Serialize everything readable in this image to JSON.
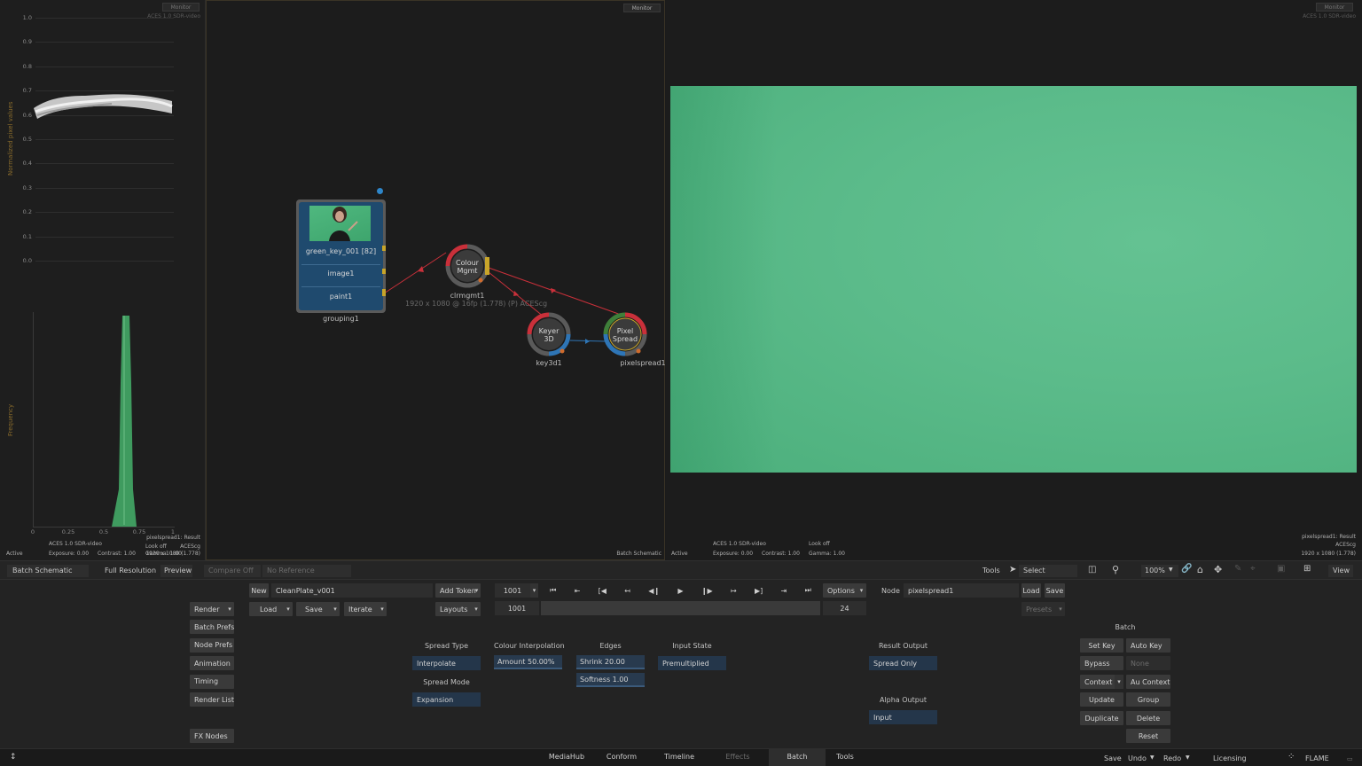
{
  "scope": {
    "monitor_btn": "Monitor",
    "colorspace_tag": "ACES 1.0 SDR-video",
    "y_axis_title": "Normalized pixel values",
    "y_ticks": [
      "1.0",
      "0.9",
      "0.8",
      "0.7",
      "0.6",
      "0.5",
      "0.4",
      "0.3",
      "0.2",
      "0.1",
      "0.0"
    ],
    "hist_axis_title": "Frequency",
    "hist_x_ticks": [
      "0",
      "0.25",
      "0.5",
      "0.75",
      "1"
    ],
    "footer": {
      "display": "ACES 1.0 SDR-video",
      "look": "Look off",
      "exposure": "Exposure: 0.00",
      "contrast": "Contrast: 1.00",
      "gamma": "Gamma: 1.00",
      "result": "pixelspread1: Result",
      "acescg": "ACEScg",
      "resolution": "1920 x 1080 (1.778)",
      "state": "Active"
    }
  },
  "schematic": {
    "monitor_btn": "Monitor",
    "group": {
      "clip_name": "green_key_001 [82]",
      "row2": "image1",
      "row3": "paint1",
      "label": "grouping1"
    },
    "colour_node": {
      "line1": "Colour",
      "line2": "Mgmt",
      "label": "clrmgmt1",
      "info": "1920 x 1080 @ 16fp (1.778) (P) ACEScg"
    },
    "keyer_node": {
      "line1": "Keyer",
      "line2": "3D",
      "label": "key3d1"
    },
    "spread_node": {
      "line1": "Pixel",
      "line2": "Spread",
      "label": "pixelspread1"
    },
    "footer_label": "Batch Schematic"
  },
  "viewer": {
    "monitor_btn": "Monitor",
    "colorspace_tag": "ACES 1.0 SDR-video",
    "footer": {
      "display": "ACES 1.0 SDR-video",
      "look": "Look off",
      "exposure": "Exposure: 0.00",
      "contrast": "Contrast: 1.00",
      "gamma": "Gamma: 1.00",
      "result": "pixelspread1: Result",
      "acescg": "ACEScg",
      "resolution": "1920 x 1080 (1.778)",
      "state": "Active"
    }
  },
  "strip": {
    "view_mode": "Batch Schematic",
    "resolution": "Full Resolution",
    "preview": "Preview",
    "compare": "Compare Off",
    "reference": "No Reference",
    "tools": "Tools",
    "select": "Select",
    "zoom": "100%",
    "view": "View"
  },
  "panel": {
    "new": "New",
    "setup_name": "CleanPlate_v001",
    "add_token": "Add Token",
    "frame": "1001",
    "options": "Options",
    "node_label": "Node",
    "node_name": "pixelspread1",
    "load": "Load",
    "save": "Save",
    "render": "Render",
    "load2": "Load",
    "save2": "Save",
    "iterate": "Iterate",
    "layouts": "Layouts",
    "range_start": "1001",
    "range_end": "24",
    "presets": "Presets",
    "left_menu": [
      "Batch Prefs",
      "Node Prefs",
      "Animation",
      "Timing",
      "Render List"
    ],
    "fx_nodes": "FX Nodes",
    "spread_type_hdr": "Spread Type",
    "spread_type_val": "Interpolate",
    "spread_mode_hdr": "Spread Mode",
    "spread_mode_val": "Expansion",
    "colour_interp_hdr": "Colour Interpolation",
    "amount": "Amount 50.00%",
    "edges_hdr": "Edges",
    "shrink": "Shrink 20.00",
    "softness": "Softness 1.00",
    "input_state_hdr": "Input State",
    "input_state_val": "Premultiplied",
    "result_output_hdr": "Result Output",
    "result_output_val": "Spread Only",
    "alpha_output_hdr": "Alpha Output",
    "alpha_output_val": "Input",
    "batch_hdr": "Batch",
    "set_key": "Set Key",
    "auto_key": "Auto Key",
    "bypass": "Bypass",
    "none": "None",
    "context": "Context",
    "au_context": "Au Context",
    "update": "Update",
    "group": "Group",
    "duplicate": "Duplicate",
    "delete": "Delete",
    "reset": "Reset"
  },
  "tabs": {
    "items": [
      "MediaHub",
      "Conform",
      "Timeline",
      "Effects",
      "Batch",
      "Tools"
    ],
    "save": "Save",
    "undo": "Undo",
    "redo": "Redo",
    "licensing": "Licensing",
    "brand": "FLAME"
  },
  "colors": {
    "node_red": "#c9303a",
    "node_yellow": "#c8a52a",
    "node_blue": "#2e75b6",
    "group_fill": "#1f4a6e",
    "plate_green": "#5bbb8a"
  }
}
